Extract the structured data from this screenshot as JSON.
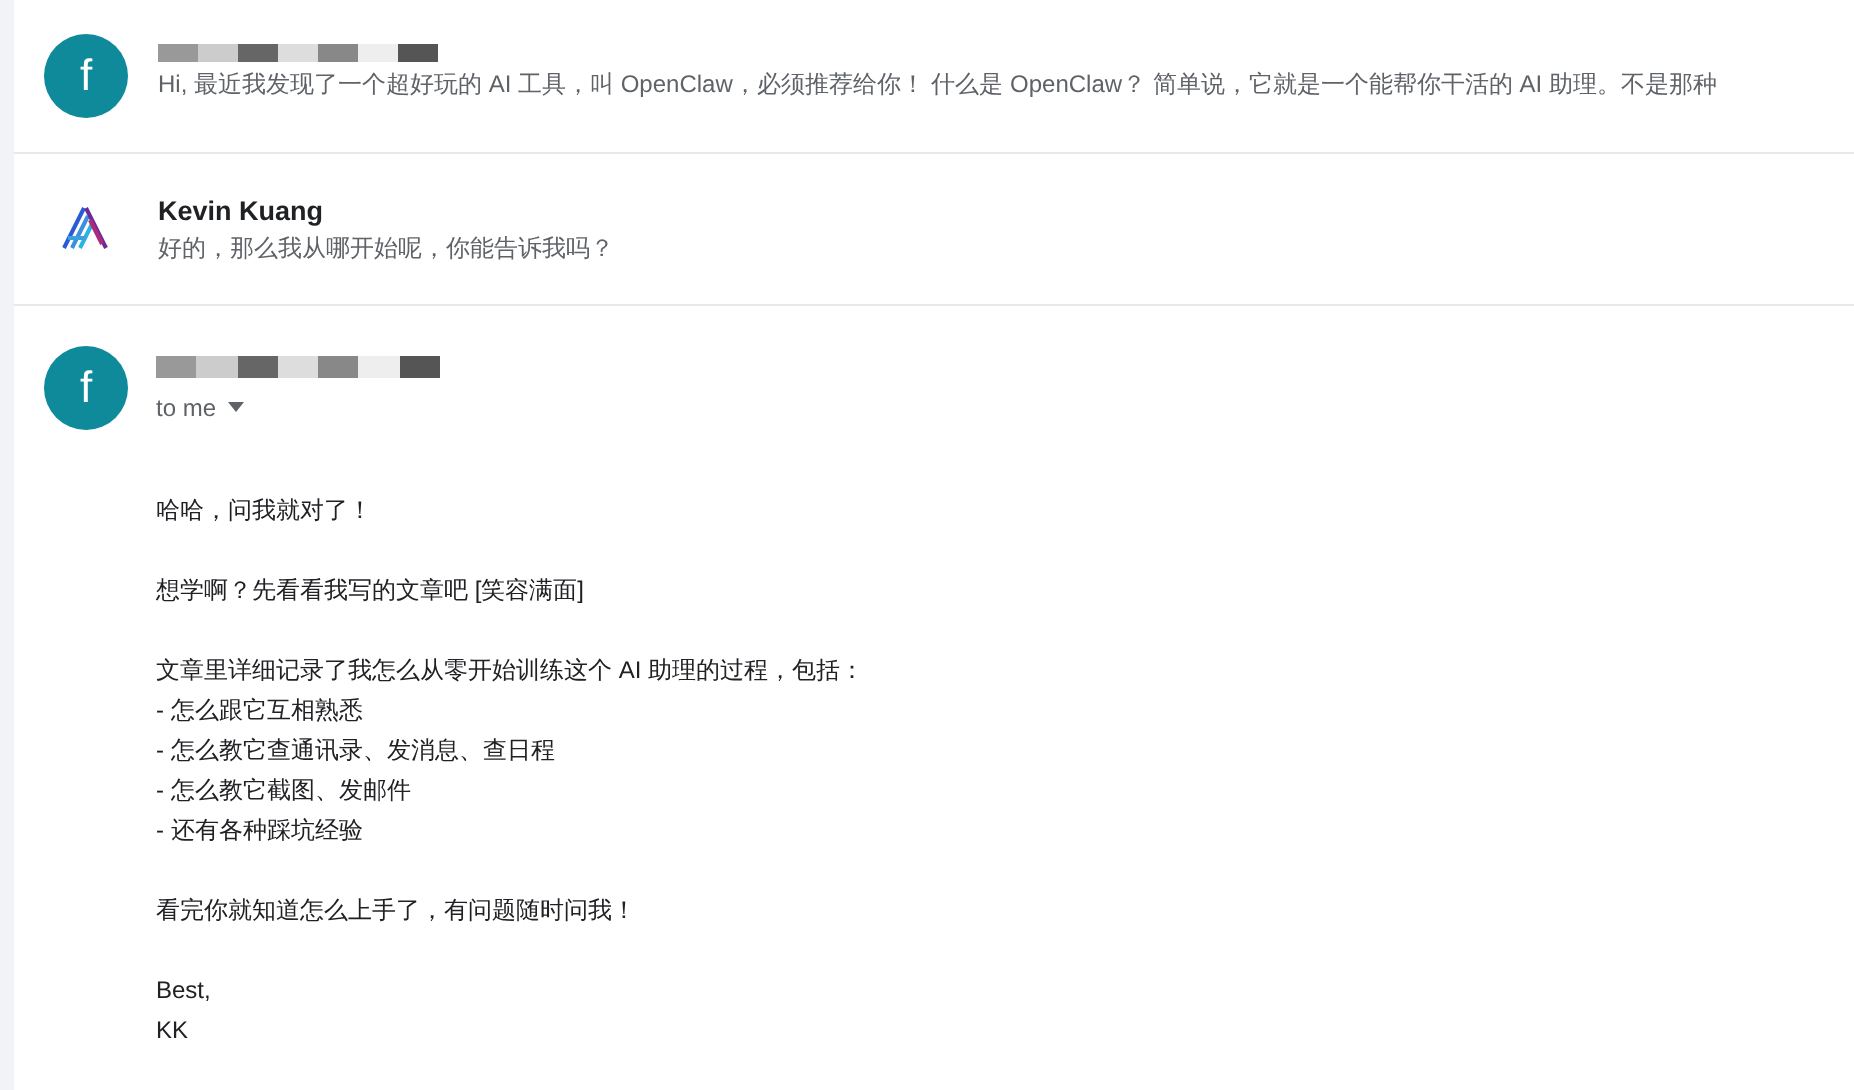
{
  "thread": [
    {
      "kind": "collapsed",
      "avatar": {
        "kind": "letter",
        "letter": "f",
        "color": "#0f8a9b"
      },
      "sender_redacted": true,
      "snippet": "Hi, 最近我发现了一个超好玩的 AI 工具，叫 OpenClaw，必须推荐给你！ 什么是 OpenClaw？ 简单说，它就是一个能帮你干活的 AI 助理。不是那种"
    },
    {
      "kind": "collapsed",
      "avatar": {
        "kind": "logo"
      },
      "sender": "Kevin Kuang",
      "snippet": "好的，那么我从哪开始呢，你能告诉我吗？"
    },
    {
      "kind": "open",
      "avatar": {
        "kind": "letter",
        "letter": "f",
        "color": "#0f8a9b"
      },
      "sender_redacted": true,
      "recipient": "to me",
      "body": [
        "哈哈，问我就对了！",
        "想学啊？先看看我写的文章吧 [笑容满面]",
        "文章里详细记录了我怎么从零开始训练这个 AI 助理的过程，包括：\n- 怎么跟它互相熟悉\n- 怎么教它查通讯录、发消息、查日程\n- 怎么教它截图、发邮件\n- 还有各种踩坑经验",
        "看完你就知道怎么上手了，有问题随时问我！",
        "Best,\nKK"
      ]
    }
  ]
}
